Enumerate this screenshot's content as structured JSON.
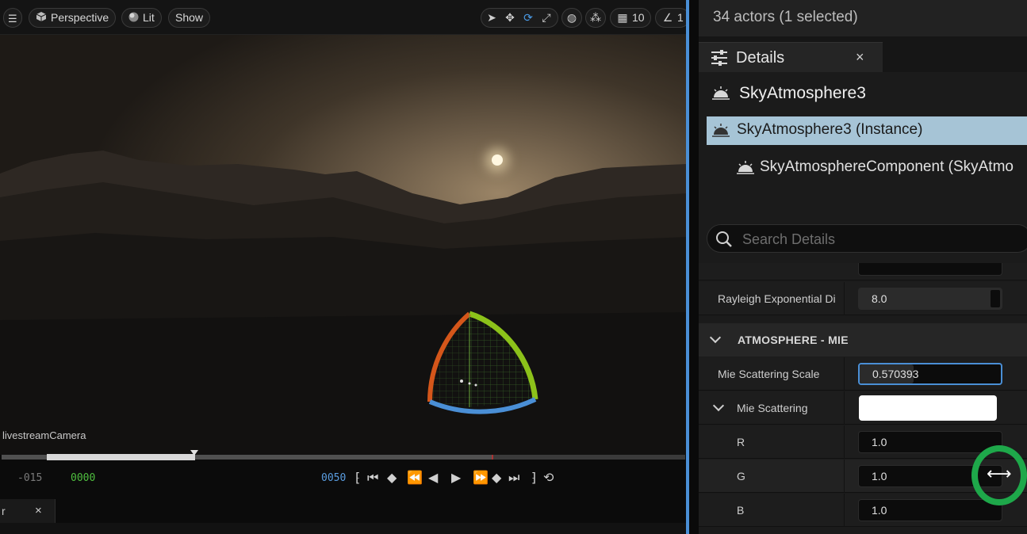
{
  "viewport": {
    "toolbar": {
      "perspective_label": "Perspective",
      "lit_label": "Lit",
      "show_label": "Show",
      "grid_value": "10",
      "angle_value": "1"
    },
    "camera_label": "livestreamCamera",
    "timeline": {
      "start": "-015",
      "current": "0000",
      "end": "0050",
      "progress_fraction": 0.28
    }
  },
  "bottom_tab": {
    "label": "r",
    "close": "×"
  },
  "details": {
    "actor_count": "34 actors (1 selected)",
    "tab_title": "Details",
    "tab_close": "×",
    "actor_name": "SkyAtmosphere3",
    "tree": [
      {
        "label": "SkyAtmosphere3 (Instance)",
        "selected": true
      },
      {
        "label": "SkyAtmosphereComponent (SkyAtmo"
      }
    ],
    "search_placeholder": "Search Details",
    "properties": {
      "rayleigh_exponential": {
        "label": "Rayleigh Exponential Di",
        "value": "8.0"
      },
      "section_mie": "ATMOSPHERE - MIE",
      "mie_scattering_scale": {
        "label": "Mie Scattering Scale",
        "value": "0.570393"
      },
      "mie_scattering": {
        "label": "Mie Scattering",
        "color": "#ffffff"
      },
      "r": {
        "label": "R",
        "value": "1.0"
      },
      "g": {
        "label": "G",
        "value": "1.0"
      },
      "b": {
        "label": "B",
        "value": "1.0"
      }
    }
  },
  "colors": {
    "accent_blue": "#4a8fd6",
    "selection_row": "#a6c4d6",
    "cursor_ring": "#1ea84a",
    "timecode_green": "#4fbf3f",
    "timecode_blue": "#5a9de0"
  }
}
